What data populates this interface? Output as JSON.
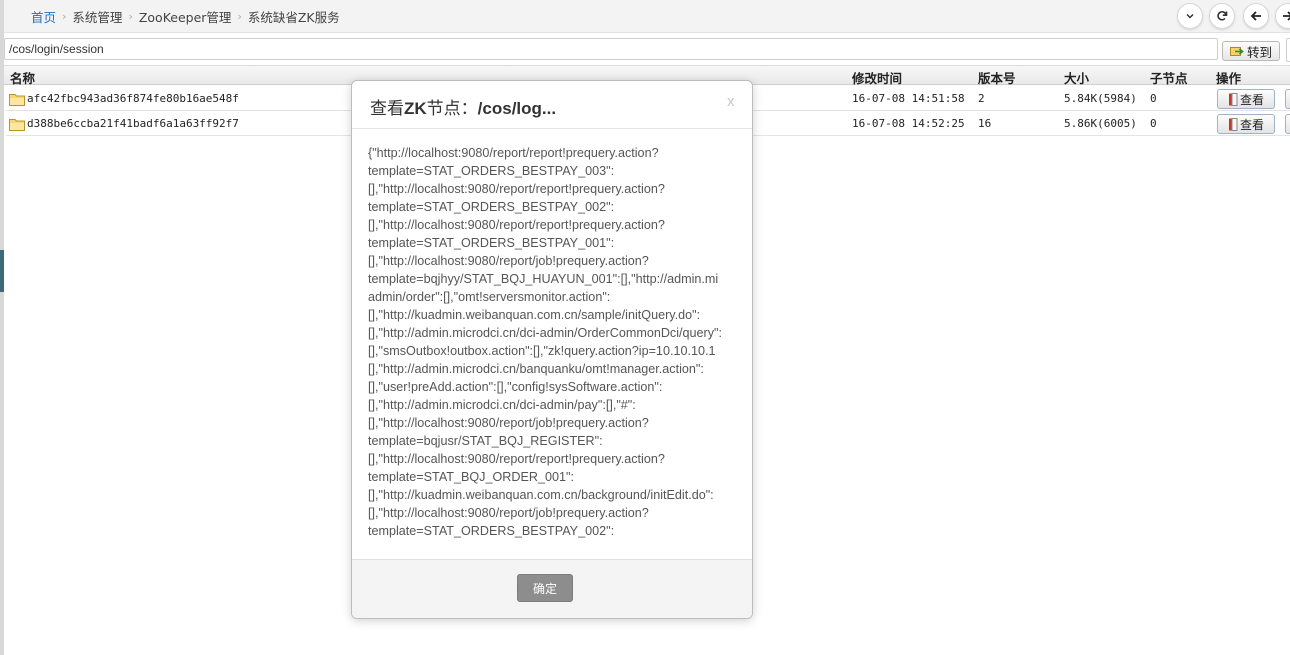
{
  "breadcrumb": {
    "items": [
      "首页",
      "系统管理",
      "ZooKeeper管理",
      "系统缺省ZK服务"
    ]
  },
  "toolbar": {
    "icons": [
      "chevron-down-icon",
      "refresh-icon",
      "arrow-left-icon",
      "arrow-right-icon"
    ]
  },
  "path_input": {
    "value": "/cos/login/session"
  },
  "goto_button": {
    "label": "转到"
  },
  "table": {
    "headers": {
      "name": "名称",
      "modified": "修改时间",
      "version": "版本号",
      "size": "大小",
      "children": "子节点",
      "actions": "操作"
    },
    "rows": [
      {
        "name": "afc42fbc943ad36f874fe80b16ae548f",
        "modified": "16-07-08 14:51:58",
        "version": "2",
        "size": "5.84K(5984)",
        "children": "0",
        "action": "查看"
      },
      {
        "name": "d388be6ccba21f41badf6a1a63ff92f7",
        "modified": "16-07-08 14:52:25",
        "version": "16",
        "size": "5.86K(6005)",
        "children": "0",
        "action": "查看"
      }
    ]
  },
  "modal": {
    "title_prefix": "查看",
    "title_zk": "ZK",
    "title_mid": "节点：",
    "title_path": "/cos/log...",
    "close": "x",
    "lines": [
      "{\"http://localhost:9080/report/report!prequery.action?",
      "template=STAT_ORDERS_BESTPAY_003\":",
      "[],\"http://localhost:9080/report/report!prequery.action?",
      "template=STAT_ORDERS_BESTPAY_002\":",
      "[],\"http://localhost:9080/report/report!prequery.action?",
      "template=STAT_ORDERS_BESTPAY_001\":",
      "[],\"http://localhost:9080/report/job!prequery.action?",
      "template=bqjhyy/STAT_BQJ_HUAYUN_001\":[],\"http://admin.mi",
      "admin/order\":[],\"omt!serversmonitor.action\":",
      "[],\"http://kuadmin.weibanquan.com.cn/sample/initQuery.do\":",
      "[],\"http://admin.microdci.cn/dci-admin/OrderCommonDci/query\":",
      "[],\"smsOutbox!outbox.action\":[],\"zk!query.action?ip=10.10.10.1",
      "[],\"http://admin.microdci.cn/banquanku/omt!manager.action\":",
      "[],\"user!preAdd.action\":[],\"config!sysSoftware.action\":",
      "[],\"http://admin.microdci.cn/dci-admin/pay\":[],\"#\":",
      "[],\"http://localhost:9080/report/job!prequery.action?",
      "template=bqjusr/STAT_BQJ_REGISTER\":",
      "[],\"http://localhost:9080/report/report!prequery.action?",
      "template=STAT_BQJ_ORDER_001\":",
      "[],\"http://kuadmin.weibanquan.com.cn/background/initEdit.do\":",
      "[],\"http://localhost:9080/report/job!prequery.action?",
      "template=STAT_ORDERS_BESTPAY_002\":"
    ],
    "ok_label": "确定"
  }
}
